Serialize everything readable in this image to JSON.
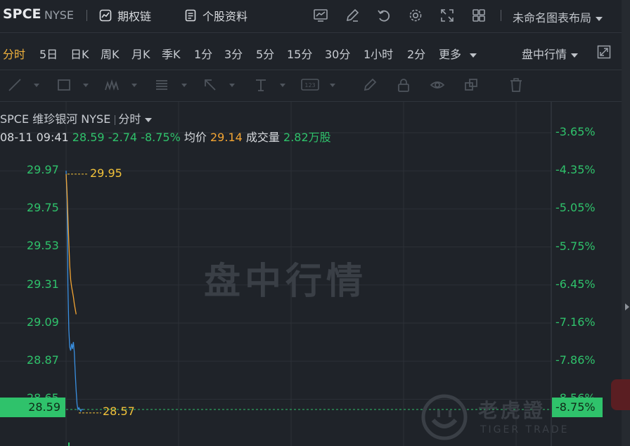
{
  "header": {
    "symbol": "SPCE",
    "exchange": "NYSE",
    "options_chain": "期权链",
    "profile": "个股资料",
    "layout_name": "未命名图表布局"
  },
  "periods": [
    "分时",
    "5日",
    "日K",
    "周K",
    "月K",
    "季K",
    "1分",
    "3分",
    "5分",
    "15分",
    "30分",
    "1小时",
    "2分",
    "更多"
  ],
  "active_period": "分时",
  "intraday_label": "盘中行情",
  "legend": {
    "symbol": "SPCE",
    "name": "维珍银河",
    "exchange": "NYSE",
    "period": "分时",
    "datetime": "08-11 09:41",
    "price": "28.59",
    "change": "-2.74",
    "change_pct": "-8.75%",
    "avg_label": "均价",
    "avg_value": "29.14",
    "volume_label": "成交量",
    "volume_value": "2.82万股"
  },
  "watermark": "盘中行情",
  "brand": {
    "cn": "老虎證",
    "en": "TIGER TRADE"
  },
  "colors": {
    "green": "#2fc26b",
    "orange": "#f3a533",
    "annotation": "#f2c23a",
    "background": "#1f2329"
  },
  "chart_data": {
    "type": "line",
    "y_ticks": [
      "29.97",
      "29.75",
      "29.53",
      "29.31",
      "29.09",
      "28.87",
      "28.65"
    ],
    "pct_ticks": [
      "-3.65%",
      "-4.35%",
      "-5.05%",
      "-5.75%",
      "-6.45%",
      "-7.16%",
      "-7.86%",
      "-8.56%"
    ],
    "ylim": [
      28.59,
      29.97
    ],
    "current_price": "28.59",
    "current_pct": "-8.75%",
    "high_annotation": "29.95",
    "low_annotation": "28.57",
    "series": [
      {
        "name": "price",
        "x": [
          0,
          1,
          2,
          3,
          4,
          5,
          6,
          7,
          8,
          9,
          10,
          11,
          12,
          13,
          14,
          15,
          16,
          17,
          18,
          19
        ],
        "values": [
          29.97,
          29.8,
          29.3,
          29.05,
          28.95,
          28.93,
          28.97,
          28.94,
          28.98,
          28.92,
          28.8,
          28.7,
          28.62,
          28.59,
          28.6,
          28.59,
          28.58,
          28.59,
          28.59,
          28.59
        ]
      },
      {
        "name": "avg",
        "x": [
          0,
          1,
          2,
          3,
          4,
          5,
          6,
          7,
          8,
          9,
          10,
          11
        ],
        "values": [
          29.95,
          29.85,
          29.7,
          29.55,
          29.42,
          29.34,
          29.3,
          29.27,
          29.24,
          29.2,
          29.17,
          29.14
        ]
      }
    ]
  }
}
